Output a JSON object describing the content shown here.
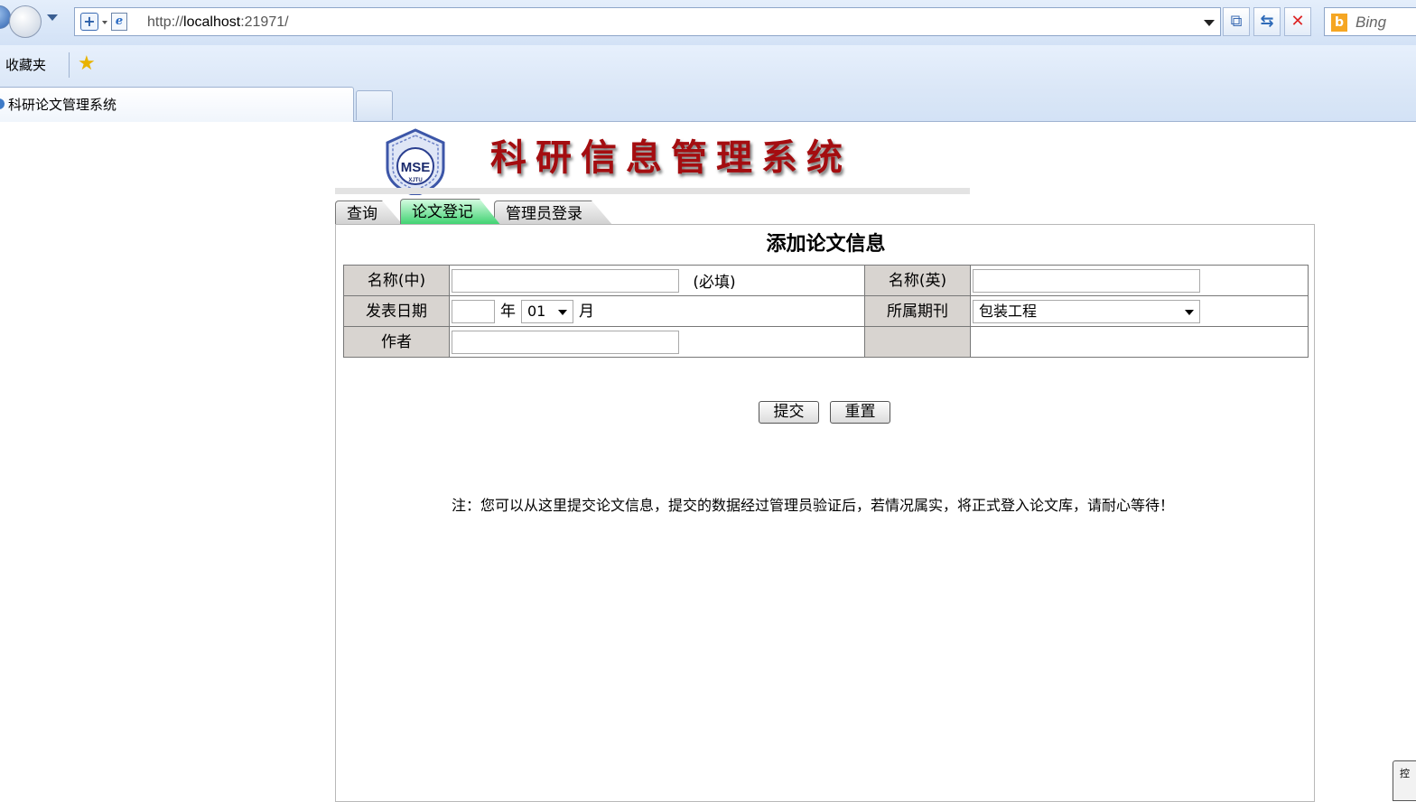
{
  "browser": {
    "url_prefix": "http://",
    "url_host": "localhost",
    "url_rest": ":21971/",
    "search_engine": "Bing",
    "favorites_label": "收藏夹",
    "tab_title": "科研论文管理系统"
  },
  "site": {
    "title": "科研信息管理系统",
    "logo_text": "MSE",
    "logo_subtext": "XJTU"
  },
  "nav": {
    "tabs": [
      {
        "label": "查询"
      },
      {
        "label": "论文登记"
      },
      {
        "label": "管理员登录"
      }
    ],
    "active_index": 1
  },
  "form": {
    "heading": "添加论文信息",
    "name_cn_label": "名称(中)",
    "required_note": "(必填)",
    "name_en_label": "名称(英)",
    "date_label": "发表日期",
    "year_unit": "年",
    "month_value": "01",
    "month_unit": "月",
    "journal_label": "所属期刊",
    "journal_value": "包装工程",
    "author_label": "作者",
    "submit_label": "提交",
    "reset_label": "重置",
    "footer_note": "注：您可以从这里提交论文信息，提交的数据经过管理员验证后，若情况属实，将正式登入论文库，请耐心等待！"
  },
  "corner_widget": {
    "text": "控"
  },
  "colors": {
    "title_red": "#a40d10",
    "active_tab_green": "#37d06b",
    "label_cell_bg": "#d8d4d0"
  }
}
